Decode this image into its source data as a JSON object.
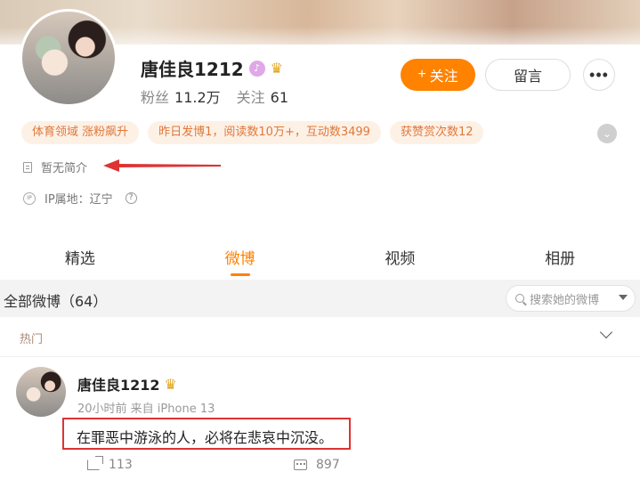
{
  "profile": {
    "username": "唐佳良1212",
    "stats": {
      "fans_label": "粉丝",
      "fans_value": "11.2万",
      "follow_label": "关注",
      "follow_value": "61"
    },
    "buttons": {
      "follow": "关注",
      "follow_plus": "+",
      "message": "留言",
      "more": "•••"
    },
    "tags": [
      "体育领域 涨粉飙升",
      "昨日发博1，阅读数10万+，互动数3499",
      "获赞赏次数12"
    ],
    "bio": "暂无简介",
    "ip": "IP属地：辽宁",
    "icons": {
      "verified_badge": "purple-verified-icon",
      "crown": "crown-icon",
      "ip": "ip-icon",
      "help": "question-icon"
    }
  },
  "tabs": [
    {
      "label": "精选",
      "active": false
    },
    {
      "label": "微博",
      "active": true
    },
    {
      "label": "视频",
      "active": false
    },
    {
      "label": "相册",
      "active": false
    }
  ],
  "feed": {
    "title": "全部微博（64）",
    "search_placeholder": "搜索她的微博",
    "section_label": "热门"
  },
  "post": {
    "author": "唐佳良1212",
    "meta": "20小时前  来自 iPhone 13",
    "text": "在罪恶中游泳的人，必将在悲哀中沉没。",
    "reposts": "113",
    "comments": "897"
  },
  "colors": {
    "accent": "#ff8200",
    "annotation": "#d33",
    "tag_text": "#e0783b",
    "tag_bg": "#fdf1e6"
  }
}
